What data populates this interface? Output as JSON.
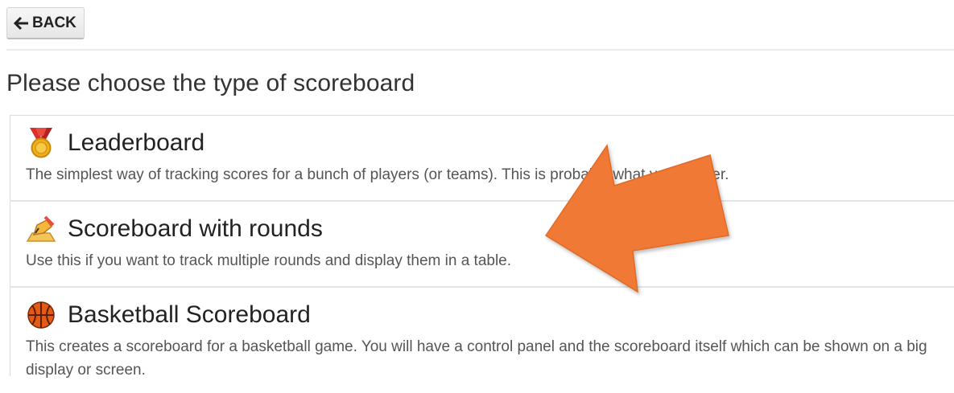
{
  "back_button": {
    "label": "BACK",
    "icon": "arrow-left-icon"
  },
  "page": {
    "title": "Please choose the type of scoreboard"
  },
  "options": [
    {
      "icon": "medal-icon",
      "title": "Leaderboard",
      "description": "The simplest way of tracking scores for a bunch of players (or teams). This is probably what you're after."
    },
    {
      "icon": "writing-hand-icon",
      "title": "Scoreboard with rounds",
      "description": "Use this if you want to track multiple rounds and display them in a table."
    },
    {
      "icon": "basketball-icon",
      "title": "Basketball Scoreboard",
      "description": "This creates a scoreboard for a basketball game. You will have a control panel and the scoreboard itself which can be shown on a big display or screen."
    }
  ],
  "colors": {
    "arrow": "#f07a35",
    "basketball": "#e55b13",
    "medal": "#f2b01e"
  }
}
